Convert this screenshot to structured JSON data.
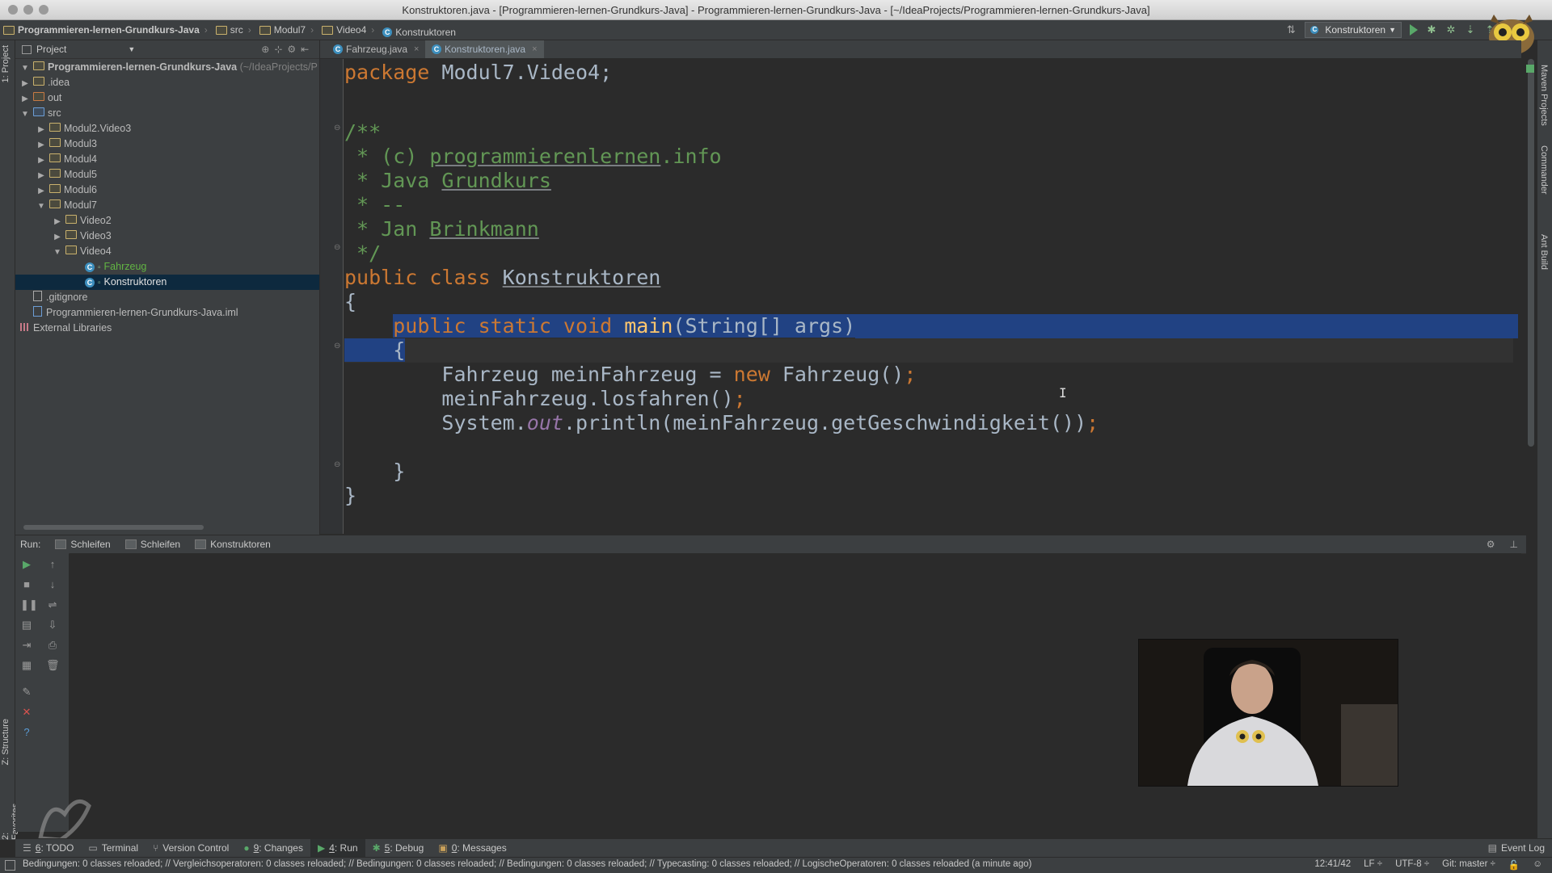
{
  "window": {
    "title": "Konstruktoren.java - [Programmieren-lernen-Grundkurs-Java] - Programmieren-lernen-Grundkurs-Java - [~/IdeaProjects/Programmieren-lernen-Grundkurs-Java]"
  },
  "breadcrumbs": [
    "Programmieren-lernen-Grundkurs-Java",
    "src",
    "Modul7",
    "Video4",
    "Konstruktoren"
  ],
  "run_config": {
    "label": "Konstruktoren"
  },
  "left_stripe": {
    "project_label": "1: Project",
    "structure_label": "Z: Structure",
    "favorites_label": "2: Favorites"
  },
  "right_stripe": {
    "maven_label": "Maven Projects",
    "commander_label": "Commander",
    "ant_label": "Ant Build"
  },
  "project_panel": {
    "header": "Project",
    "root": {
      "name": "Programmieren-lernen-Grundkurs-Java",
      "path": "(~/IdeaProjects/P"
    },
    "items": [
      {
        "label": ".idea"
      },
      {
        "label": "out"
      },
      {
        "label": "src"
      },
      {
        "label": "Modul2.Video3"
      },
      {
        "label": "Modul3"
      },
      {
        "label": "Modul4"
      },
      {
        "label": "Modul5"
      },
      {
        "label": "Modul6"
      },
      {
        "label": "Modul7"
      },
      {
        "label": "Video2"
      },
      {
        "label": "Video3"
      },
      {
        "label": "Video4"
      },
      {
        "label": "Fahrzeug"
      },
      {
        "label": "Konstruktoren"
      },
      {
        "label": ".gitignore"
      },
      {
        "label": "Programmieren-lernen-Grundkurs-Java.iml"
      },
      {
        "label": "External Libraries"
      }
    ]
  },
  "editor_tabs": [
    {
      "label": "Fahrzeug.java",
      "close": "×"
    },
    {
      "label": "Konstruktoren.java",
      "close": "×"
    }
  ],
  "code": {
    "pkg_kw": "package",
    "pkg_name": " Modul7.Video4;",
    "c_open": "/**",
    "c1_pre": " * (c) ",
    "c1_link": "programmierenlernen",
    "c1_post": ".info",
    "c2_pre": " * Java ",
    "c2_word": "Grundkurs",
    "c3": " * --",
    "c4_pre": " * Jan ",
    "c4_word": "Brinkmann",
    "c_close": " */",
    "class_kw": "public class ",
    "class_name": "Konstruktoren",
    "brace_open": "{",
    "main_indent": "    ",
    "main_kw": "public static void ",
    "main_name": "main",
    "main_args": "(String[] args)",
    "m_brace_open": "    {",
    "s1_a": "        Fahrzeug meinFahrzeug = ",
    "s1_kw": "new",
    "s1_b": " Fahrzeug()",
    "semi": ";",
    "s2": "        meinFahrzeug.losfahren()",
    "s3_a": "        System.",
    "s3_out": "out",
    "s3_b": ".println(meinFahrzeug.getGeschwindigkeit())",
    "m_brace_close": "    }",
    "brace_close": "}"
  },
  "run_panel": {
    "label": "Run:",
    "tabs": [
      "Schleifen",
      "Schleifen",
      "Konstruktoren"
    ]
  },
  "bottom_toolbar": [
    {
      "num": "6",
      "label": ": TODO"
    },
    {
      "num": "",
      "label": "Terminal"
    },
    {
      "num": "",
      "label": "Version Control"
    },
    {
      "num": "9",
      "label": ": Changes"
    },
    {
      "num": "4",
      "label": ": Run"
    },
    {
      "num": "5",
      "label": ": Debug"
    },
    {
      "num": "0",
      "label": ": Messages"
    }
  ],
  "event_log": "Event Log",
  "status": {
    "message": "Bedingungen: 0 classes reloaded; // Vergleichsoperatoren: 0 classes reloaded; // Bedingungen: 0 classes reloaded; // Bedingungen: 0 classes reloaded; // Typecasting: 0 classes reloaded; // LogischeOperatoren: 0 classes reloaded (a minute ago)",
    "position": "12:41/42",
    "line_sep": "LF ÷",
    "encoding": "UTF-8 ÷",
    "git": "Git: master ÷"
  },
  "colors": {
    "keyword": "#cc7832",
    "comment": "#629755",
    "method": "#ffc66d",
    "static_field": "#9876aa",
    "selection": "#214283",
    "run_green": "#59a869"
  }
}
